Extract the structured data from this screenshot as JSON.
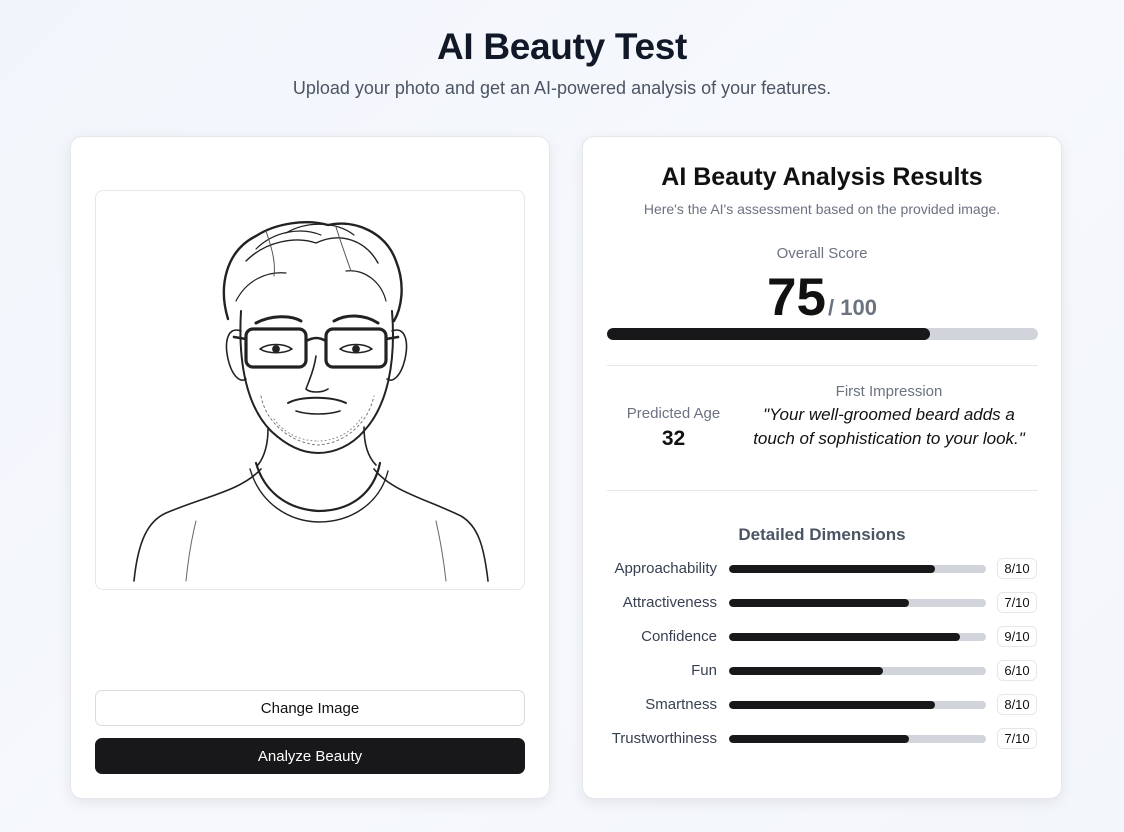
{
  "header": {
    "title": "AI Beauty Test",
    "subtitle": "Upload your photo and get an AI-powered analysis of your features."
  },
  "upload": {
    "change_image_label": "Change Image",
    "analyze_label": "Analyze Beauty"
  },
  "results": {
    "title": "AI Beauty Analysis Results",
    "subtitle": "Here's the AI's assessment based on the provided image.",
    "overall_label": "Overall Score",
    "overall_score": "75",
    "overall_max": "/ 100",
    "overall_fraction": 0.75,
    "predicted_age_label": "Predicted Age",
    "predicted_age": "32",
    "first_impression_label": "First Impression",
    "first_impression": "\"Your well-groomed beard adds a touch of sophistication to your look.\"",
    "dimensions_title": "Detailed Dimensions",
    "dimensions": [
      {
        "label": "Approachability",
        "score": 8,
        "badge": "8/10"
      },
      {
        "label": "Attractiveness",
        "score": 7,
        "badge": "7/10"
      },
      {
        "label": "Confidence",
        "score": 9,
        "badge": "9/10"
      },
      {
        "label": "Fun",
        "score": 6,
        "badge": "6/10"
      },
      {
        "label": "Smartness",
        "score": 8,
        "badge": "8/10"
      },
      {
        "label": "Trustworthiness",
        "score": 7,
        "badge": "7/10"
      }
    ]
  },
  "colors": {
    "bar_fill": "#18181b",
    "bar_track": "#d1d5db",
    "primary_button": "#18181b"
  }
}
